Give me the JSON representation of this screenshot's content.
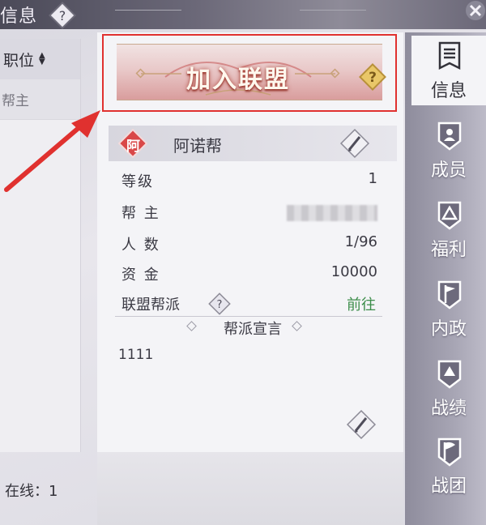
{
  "top": {
    "title": "信息",
    "help_icon": "question-diamond-icon",
    "close_icon": "close-icon"
  },
  "left_list": {
    "header": "职位",
    "sort_icon": "sort-arrows-icon",
    "rows": [
      "帮主"
    ],
    "online_text": "在线：1"
  },
  "join": {
    "label": "加入联盟",
    "help_icon": "question-diamond-icon",
    "highlight_color": "#e0312f"
  },
  "guild": {
    "badge": "阿",
    "badge_color": "#d94848",
    "name": "阿诺帮",
    "edit_icon": "pencil-icon"
  },
  "info": {
    "level_label": "等级",
    "level_value": "1",
    "leader_label": "帮 主",
    "members_label": "人 数",
    "members_value": "1/96",
    "funds_label": "资 金",
    "funds_value": "10000",
    "alliance_label": "联盟帮派",
    "alliance_help_icon": "question-diamond-icon",
    "alliance_link": "前往",
    "link_color": "#3c8d4a"
  },
  "declaration": {
    "title": "帮派宣言",
    "text": "1111",
    "edit_icon": "pencil-icon"
  },
  "tabs": [
    {
      "label": "信息",
      "icon": "banner-list-icon",
      "active": true
    },
    {
      "label": "成员",
      "icon": "member-shield-icon",
      "active": false
    },
    {
      "label": "福利",
      "icon": "welfare-shield-icon",
      "active": false
    },
    {
      "label": "内政",
      "icon": "flag-shield-icon",
      "active": false
    },
    {
      "label": "战绩",
      "icon": "record-shield-icon",
      "active": false
    },
    {
      "label": "战团",
      "icon": "battle-flag-icon",
      "active": false
    }
  ],
  "colors": {
    "accent_red": "#e0312f",
    "panel_bg": "#f4f4f7",
    "rail_bg": "#a7a5b4"
  }
}
